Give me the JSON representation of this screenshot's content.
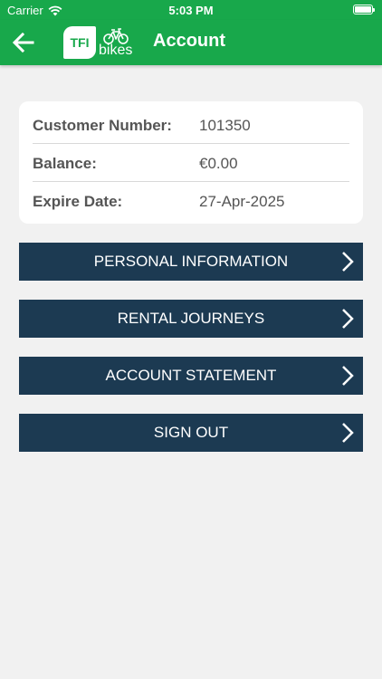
{
  "status_bar": {
    "carrier": "Carrier",
    "time": "5:03 PM"
  },
  "header": {
    "logo_text": "TFI",
    "logo_sub": "bikes",
    "title": "Account"
  },
  "account": {
    "rows": [
      {
        "label": "Customer Number:",
        "value": "101350"
      },
      {
        "label": "Balance:",
        "value": "€0.00"
      },
      {
        "label": "Expire Date:",
        "value": "27-Apr-2025"
      }
    ]
  },
  "menu": [
    {
      "label": "PERSONAL INFORMATION"
    },
    {
      "label": "RENTAL JOURNEYS"
    },
    {
      "label": "ACCOUNT STATEMENT"
    },
    {
      "label": "SIGN OUT"
    }
  ],
  "colors": {
    "brand_green": "#18a84b",
    "button_navy": "#1c3a52",
    "background": "#f1f1f1"
  }
}
